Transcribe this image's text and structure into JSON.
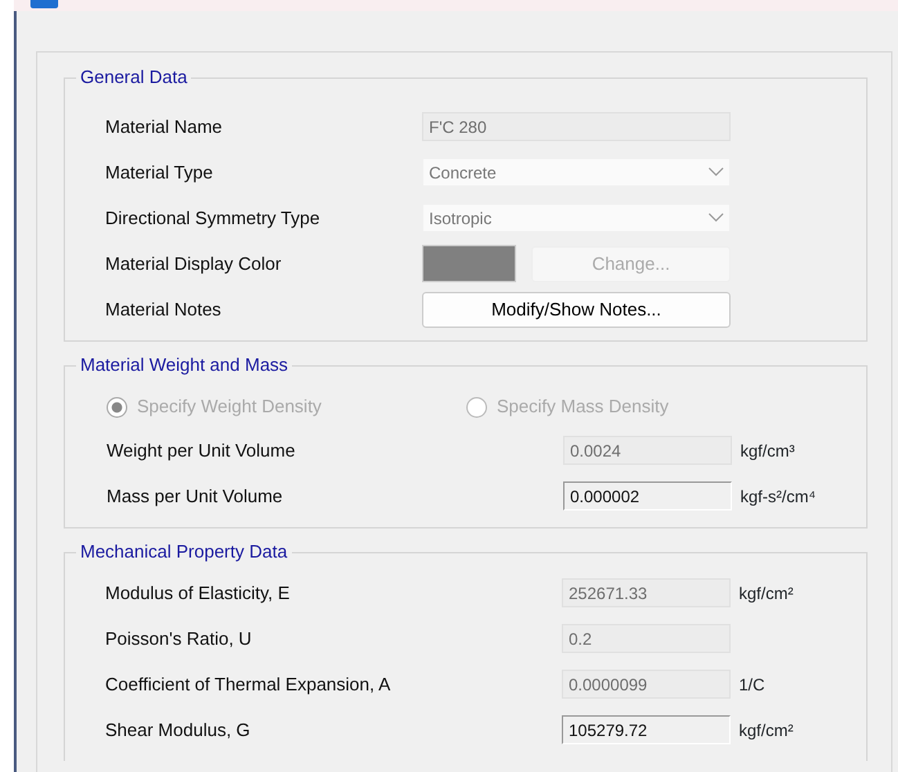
{
  "general": {
    "title": "General Data",
    "rows": [
      {
        "kind": "text",
        "label": "Material Name",
        "value": "F'C 280",
        "disabled": true
      },
      {
        "kind": "select",
        "label": "Material Type",
        "value": "Concrete",
        "disabled": true
      },
      {
        "kind": "select",
        "label": "Directional Symmetry Type",
        "value": "Isotropic",
        "disabled": true
      },
      {
        "kind": "color",
        "label": "Material Display Color",
        "color": "#808080",
        "button": "Change...",
        "disabled": true
      },
      {
        "kind": "button",
        "label": "Material Notes",
        "button": "Modify/Show Notes...",
        "disabled": false
      }
    ]
  },
  "weight": {
    "title": "Material Weight and Mass",
    "options": [
      {
        "label": "Specify Weight Density",
        "selected": true,
        "disabled": true
      },
      {
        "label": "Specify Mass Density",
        "selected": false,
        "disabled": true
      }
    ],
    "rows": [
      {
        "label": "Weight per Unit Volume",
        "value": "0.0024",
        "unit": "kgf/cm³",
        "disabled": true
      },
      {
        "label": "Mass per Unit Volume",
        "value": "0.000002",
        "unit": "kgf-s²/cm⁴",
        "disabled": false
      }
    ]
  },
  "mechanical": {
    "title": "Mechanical Property Data",
    "rows": [
      {
        "label": "Modulus of Elasticity,  E",
        "value": "252671.33",
        "unit": "kgf/cm²",
        "disabled": true
      },
      {
        "label": "Poisson's Ratio,  U",
        "value": "0.2",
        "disabled": true
      },
      {
        "label": "Coefficient of Thermal Expansion,  A",
        "value": "0.0000099",
        "unit": "1/C",
        "disabled": true
      },
      {
        "label": "Shear Modulus,  G",
        "value": "105279.72",
        "unit": "kgf/cm²",
        "disabled": false
      }
    ]
  }
}
